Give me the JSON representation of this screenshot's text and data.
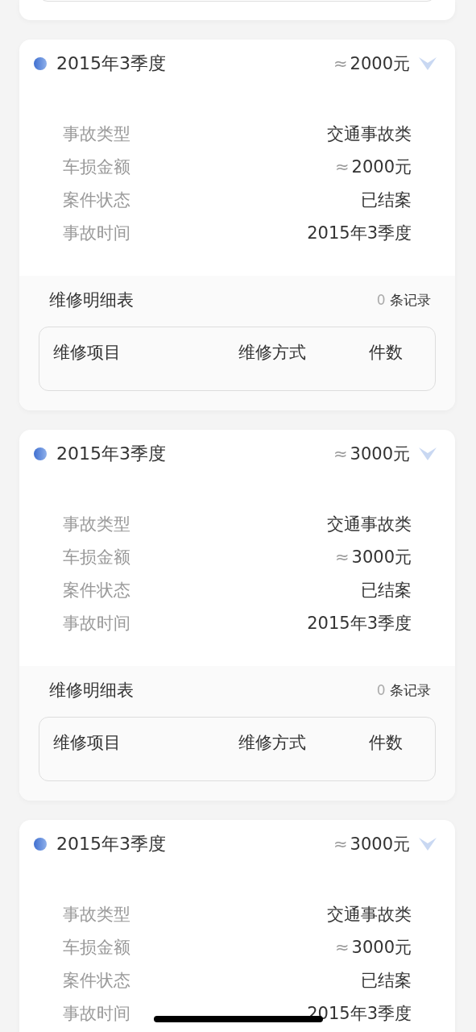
{
  "cards": [
    {
      "title": "2015年3季度",
      "approx": "≈",
      "amount": "2000元",
      "expanded": true,
      "rows": [
        {
          "label": "事故类型",
          "value": "交通事故类"
        },
        {
          "label": "车损金额",
          "approx": "≈",
          "value": "2000元"
        },
        {
          "label": "案件状态",
          "value": "已结案"
        },
        {
          "label": "事故时间",
          "value": "2015年3季度"
        }
      ],
      "repair": {
        "title": "维修明细表",
        "count": "0",
        "unit": "条记录",
        "columns": [
          "维修项目",
          "维修方式",
          "件数"
        ]
      }
    },
    {
      "title": "2015年3季度",
      "approx": "≈",
      "amount": "3000元",
      "expanded": true,
      "rows": [
        {
          "label": "事故类型",
          "value": "交通事故类"
        },
        {
          "label": "车损金额",
          "approx": "≈",
          "value": "3000元"
        },
        {
          "label": "案件状态",
          "value": "已结案"
        },
        {
          "label": "事故时间",
          "value": "2015年3季度"
        }
      ],
      "repair": {
        "title": "维修明细表",
        "count": "0",
        "unit": "条记录",
        "columns": [
          "维修项目",
          "维修方式",
          "件数"
        ]
      }
    },
    {
      "title": "2015年3季度",
      "approx": "≈",
      "amount": "3000元",
      "expanded": true,
      "rows": [
        {
          "label": "事故类型",
          "value": "交通事故类"
        },
        {
          "label": "车损金额",
          "approx": "≈",
          "value": "3000元"
        },
        {
          "label": "案件状态",
          "value": "已结案"
        },
        {
          "label": "事故时间",
          "value": "2015年3季度"
        }
      ]
    }
  ]
}
